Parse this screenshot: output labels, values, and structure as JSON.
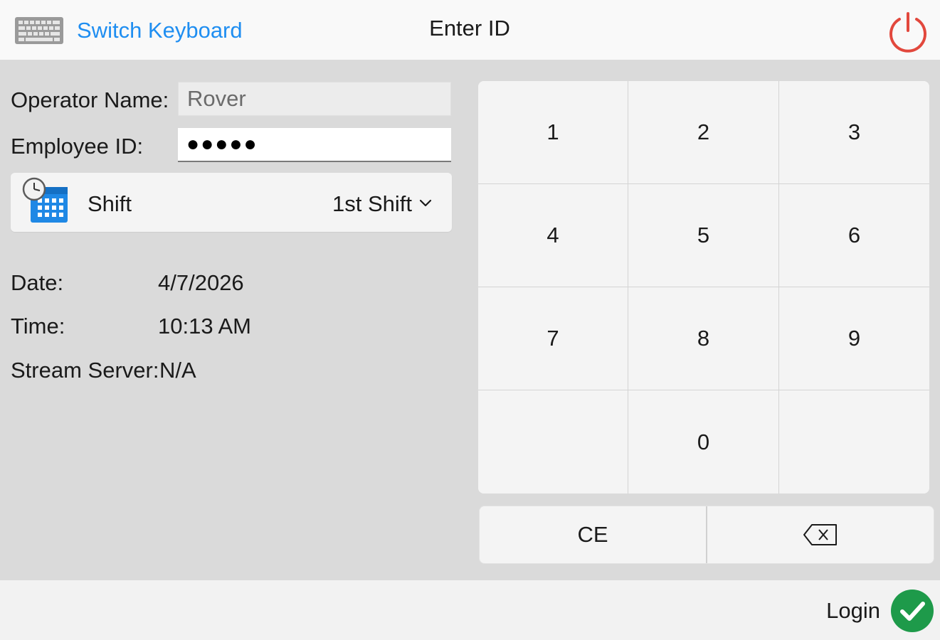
{
  "header": {
    "switch_keyboard_label": "Switch Keyboard",
    "title": "Enter ID",
    "keyboard_icon": "keyboard-icon",
    "power_icon": "power-icon",
    "power_color": "#e2483d",
    "accent_color": "#1f8ef1"
  },
  "form": {
    "operator_name_label": "Operator Name:",
    "operator_name_value": "Rover",
    "employee_id_label": "Employee ID:",
    "employee_id_value": "●●●●●",
    "shift": {
      "label": "Shift",
      "selected": "1st Shift",
      "icon": "calendar-clock-icon"
    }
  },
  "info": {
    "date_label": "Date:",
    "date_value": "4/7/2026",
    "time_label": "Time:",
    "time_value": "10:13 AM",
    "stream_label": "Stream Server:",
    "stream_value": "N/A"
  },
  "keypad": {
    "keys": [
      "1",
      "2",
      "3",
      "4",
      "5",
      "6",
      "7",
      "8",
      "9",
      "",
      "0",
      ""
    ],
    "ce_label": "CE",
    "backspace_icon": "backspace-icon"
  },
  "footer": {
    "login_label": "Login",
    "login_icon": "checkmark-circle-icon",
    "login_color": "#1e9a4a"
  }
}
